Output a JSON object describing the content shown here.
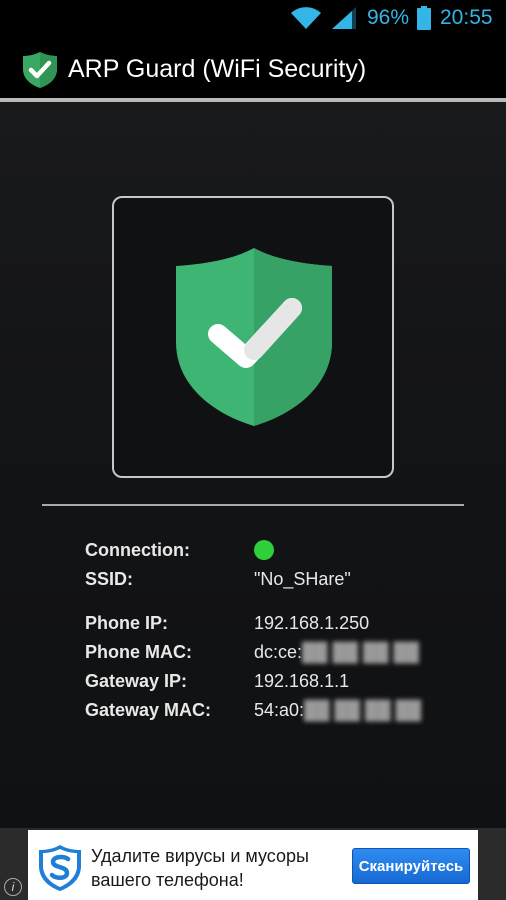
{
  "status_bar": {
    "battery_percent": "96%",
    "time": "20:55",
    "icons": [
      "wifi-icon",
      "signal-icon",
      "battery-icon"
    ],
    "accent_color": "#33b5e5"
  },
  "action_bar": {
    "title": "ARP Guard (WiFi Security)",
    "icon": "shield-check-icon"
  },
  "status": {
    "shield_state": "protected",
    "shield_color": "#3daf6f",
    "connection_indicator_color": "#2ed03a"
  },
  "info": {
    "connection_label": "Connection:",
    "ssid_label": "SSID:",
    "ssid_value": "\"No_SHare\"",
    "phone_ip_label": "Phone IP:",
    "phone_ip_value": "192.168.1.250",
    "phone_mac_label": "Phone MAC:",
    "phone_mac_value": "dc:ce:",
    "gateway_ip_label": "Gateway IP:",
    "gateway_ip_value": "192.168.1.1",
    "gateway_mac_label": "Gateway MAC:",
    "gateway_mac_value": "54:a0:"
  },
  "ad": {
    "text_line1": "Удалите вирусы и мусоры",
    "text_line2": "вашего телефона!",
    "button_label": "Сканируйтесь",
    "info_glyph": "i"
  }
}
